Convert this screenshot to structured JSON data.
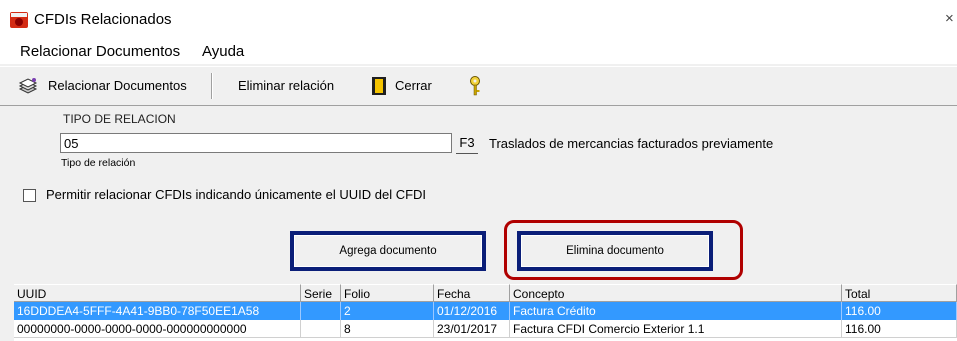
{
  "window": {
    "title": "CFDIs Relacionados",
    "close": "×"
  },
  "menu": {
    "items": [
      "Relacionar Documentos",
      "Ayuda"
    ]
  },
  "toolbar": {
    "relacionar": "Relacionar Documentos",
    "eliminar": "Eliminar relación",
    "cerrar": "Cerrar"
  },
  "relacion": {
    "group_label": "TIPO DE RELACION",
    "value": "05",
    "f3": "F3",
    "description": "Traslados de mercancias facturados previamente",
    "caption": "Tipo de relación"
  },
  "uuid_option": {
    "label": "Permitir relacionar CFDIs indicando únicamente el UUID del CFDI",
    "checked": false
  },
  "buttons": {
    "agrega": "Agrega documento",
    "elimina": "Elimina documento"
  },
  "table": {
    "headers": [
      "UUID",
      "Serie",
      "Folio",
      "Fecha",
      "Concepto",
      "Total"
    ],
    "rows": [
      [
        "16DDDEA4-5FFF-4A41-9BB0-78F50EE1A58",
        "",
        "2",
        "01/12/2016",
        "Factura Crédito",
        "116.00"
      ],
      [
        "00000000-0000-0000-0000-000000000000",
        "",
        "8",
        "23/01/2017",
        "Factura CFDI Comercio Exterior 1.1",
        "116.00"
      ]
    ]
  },
  "colors": {
    "selection": "#3399ff",
    "button_frame": "#0a1e78",
    "highlight": "#b00000"
  }
}
